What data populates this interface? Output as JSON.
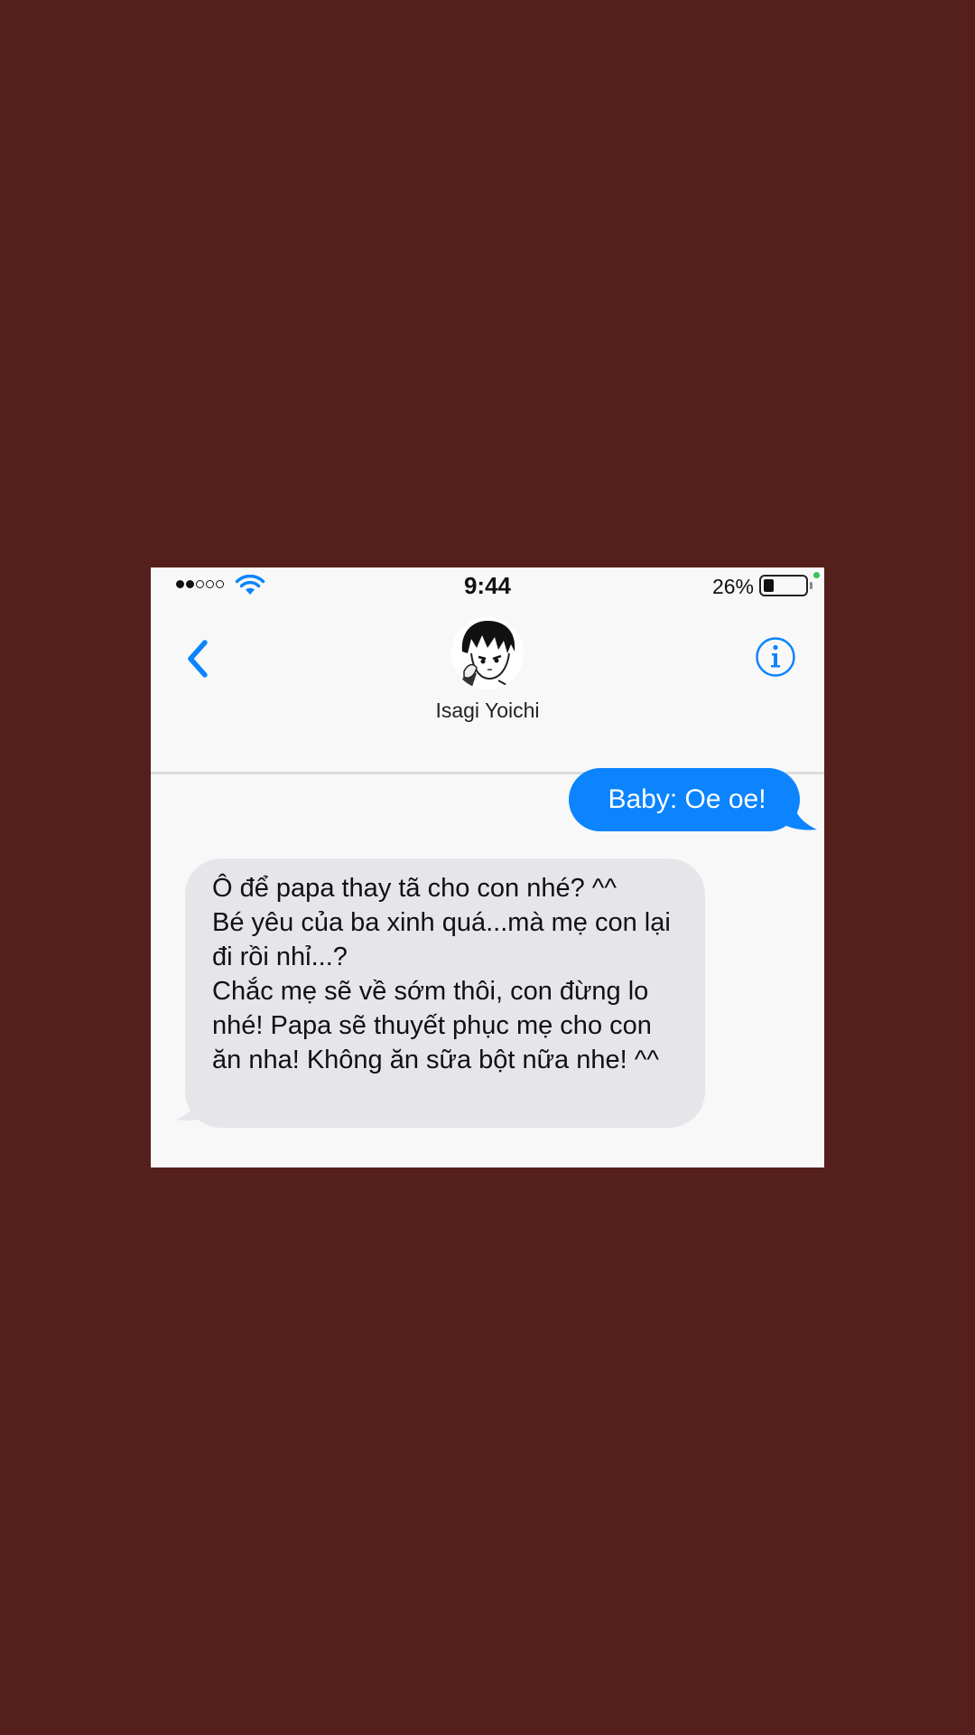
{
  "colors": {
    "background": "#551f1c",
    "screen": "#f8f8f8",
    "accent": "#0b84fe",
    "incoming_bubble": "#e6e5ea"
  },
  "status_bar": {
    "time": "9:44",
    "battery_percent": "26%",
    "battery_level": 0.26,
    "signal_bars_filled": 2,
    "signal_bars_total": 5,
    "icons": [
      "signal-dots-icon",
      "wifi-icon",
      "battery-icon"
    ]
  },
  "header": {
    "contact_name": "Isagi Yoichi",
    "icons": [
      "back-chevron-icon",
      "avatar",
      "info-icon"
    ]
  },
  "messages": [
    {
      "direction": "outgoing",
      "text": "Baby: Oe oe!"
    },
    {
      "direction": "incoming",
      "text": "Ô để papa thay tã cho con nhé? ^^\nBé yêu của ba xinh quá...mà mẹ con lại đi rồi nhỉ...?\nChắc mẹ sẽ về sớm thôi, con đừng lo nhé! Papa sẽ thuyết phục mẹ cho con ăn nha! Không ăn sữa bột nữa nhe! ^^"
    }
  ]
}
